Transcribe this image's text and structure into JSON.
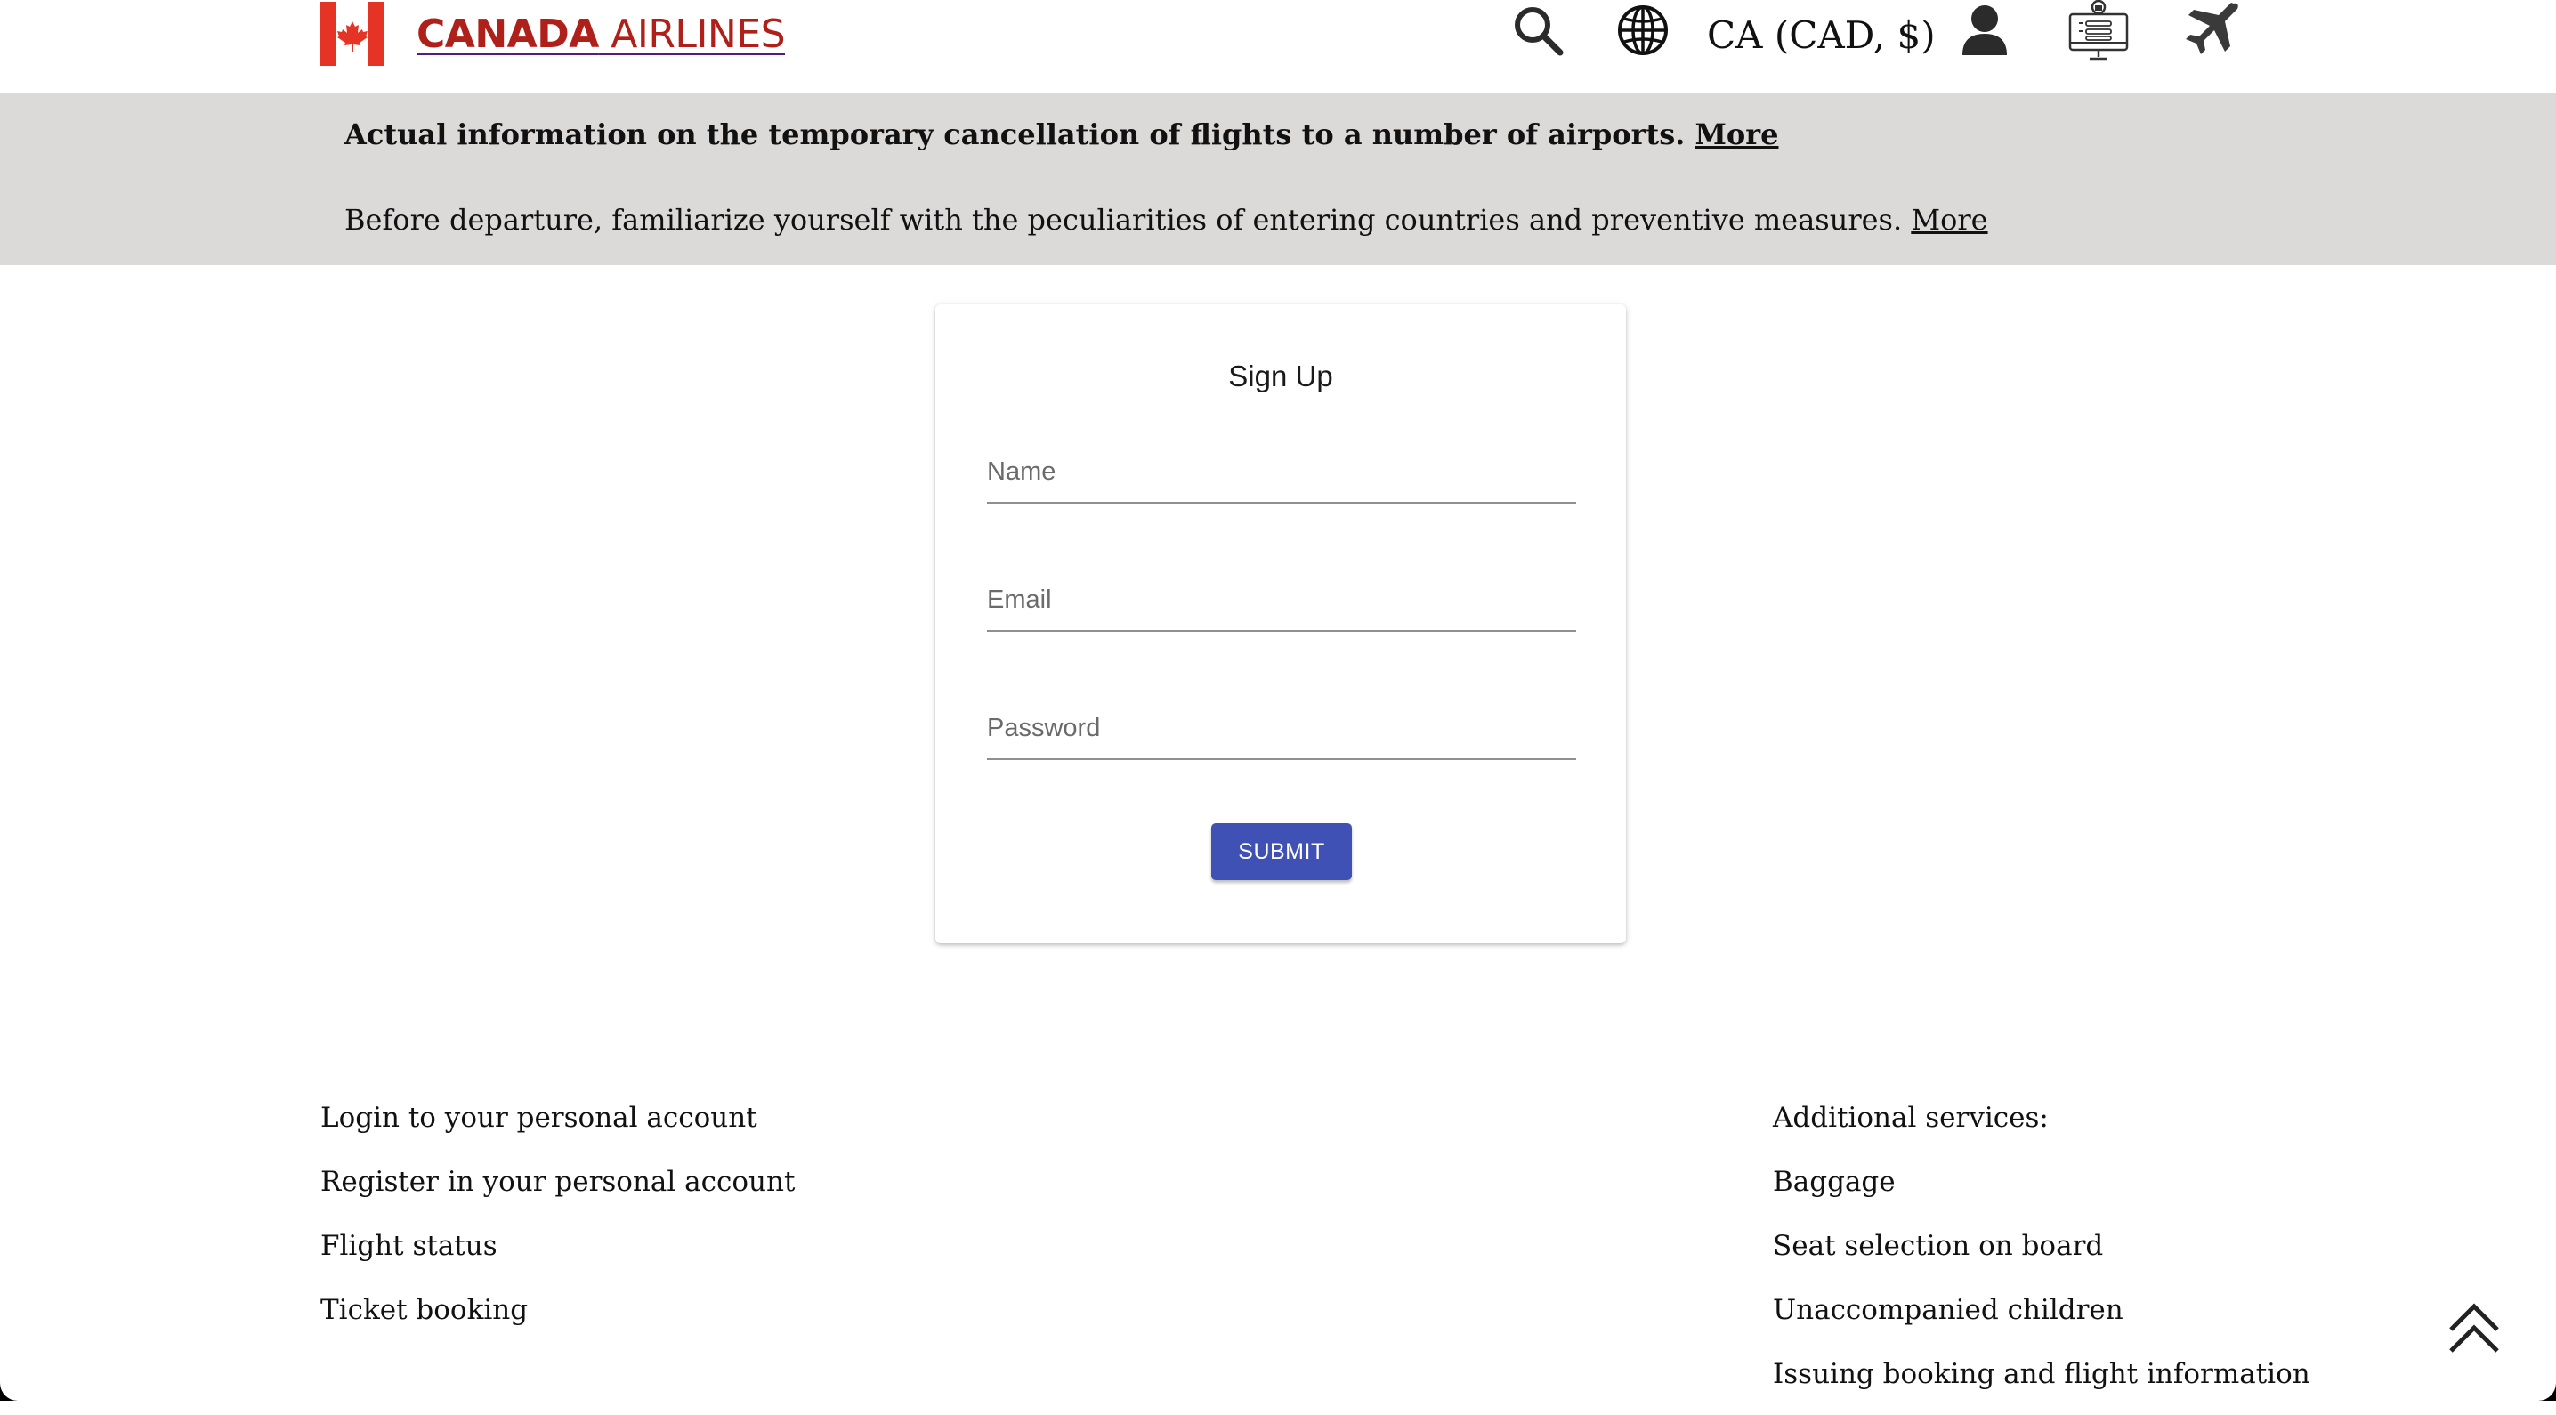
{
  "header": {
    "logo": {
      "bold": "CANADA",
      "light": " AIRLINES"
    },
    "locale": "CA (CAD, $)",
    "icons": [
      "search-icon",
      "globe-icon",
      "user-icon",
      "online-checkin-icon",
      "flight-icon"
    ]
  },
  "notice": {
    "line1": "Actual information on the temporary cancellation of flights to a number of airports.",
    "line1_link": "More",
    "line2": "Before departure, familiarize yourself with the peculiarities of entering countries and preventive measures.",
    "line2_link": "More"
  },
  "signup": {
    "title": "Sign Up",
    "name_placeholder": "Name",
    "email_placeholder": "Email",
    "password_placeholder": "Password",
    "name_value": "",
    "email_value": "",
    "password_value": "",
    "submit_label": "SUBMIT"
  },
  "footer": {
    "left": [
      "Login to your personal account",
      "Register in your personal account",
      "Flight status",
      "Ticket booking"
    ],
    "right_heading": "Additional services:",
    "right": [
      "Baggage",
      "Seat selection on board",
      "Unaccompanied children",
      "Issuing booking and flight information"
    ]
  },
  "colors": {
    "brand_red": "#b0201a",
    "flag_red": "#e53425",
    "banner_bg": "#dcd9d9",
    "primary_button": "#3f51b5"
  }
}
